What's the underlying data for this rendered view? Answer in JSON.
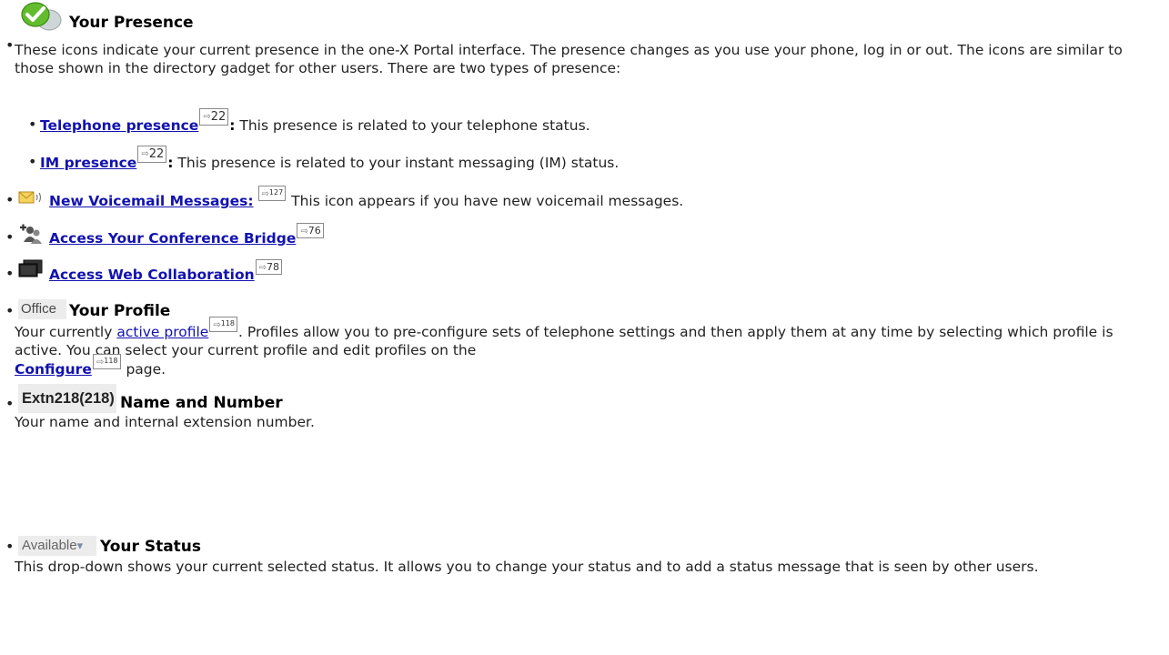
{
  "presence": {
    "title": "Your Presence",
    "description": "These icons indicate your current presence in the one-X Portal interface. The presence changes as you use your phone, log in or out. The icons are similar to those shown in the directory gadget for other users. There are two types of presence:",
    "types": [
      {
        "link": "Telephone presence",
        "ref": "22",
        "colon": ":",
        "text": " This presence is related to your telephone status."
      },
      {
        "link": "IM presence",
        "ref": "22",
        "colon": ":",
        "text": " This presence is related to your instant messaging (IM) status."
      }
    ]
  },
  "voicemail": {
    "link": "New Voicemail Messages:",
    "ref": "127",
    "text": " This icon appears if you have new voicemail messages."
  },
  "conference": {
    "link": "Access Your Conference Bridge",
    "ref": "76"
  },
  "collaboration": {
    "link": "Access Web Collaboration",
    "ref": "78"
  },
  "profile": {
    "tag": "Office",
    "title": "Your Profile",
    "text_before": "Your currently ",
    "link": "active profile",
    "ref": "118",
    "text_after": ". Profiles allow you to pre-configure sets of telephone settings and then apply them at any time by selecting which profile is active. You can select your current profile and edit profiles on the",
    "link2": "Configure",
    "ref2": "118",
    "text_end": " page."
  },
  "name": {
    "tag": "Extn218(218)",
    "title": "Name and Number",
    "text": "Your name and internal extension number."
  },
  "status": {
    "tag": "Available",
    "tag_arrow": "▾",
    "title": "Your Status",
    "text": "This drop-down shows your current selected status. It allows you to change your status and to add a status message that is seen by other users."
  },
  "colors": {
    "link": "#1212b0",
    "presence_green": "#5cb82e",
    "voicemail_yellow": "#f2cd54"
  },
  "icons": [
    "presence-icon",
    "voicemail-icon",
    "conference-bridge-icon",
    "web-collaboration-icon"
  ]
}
